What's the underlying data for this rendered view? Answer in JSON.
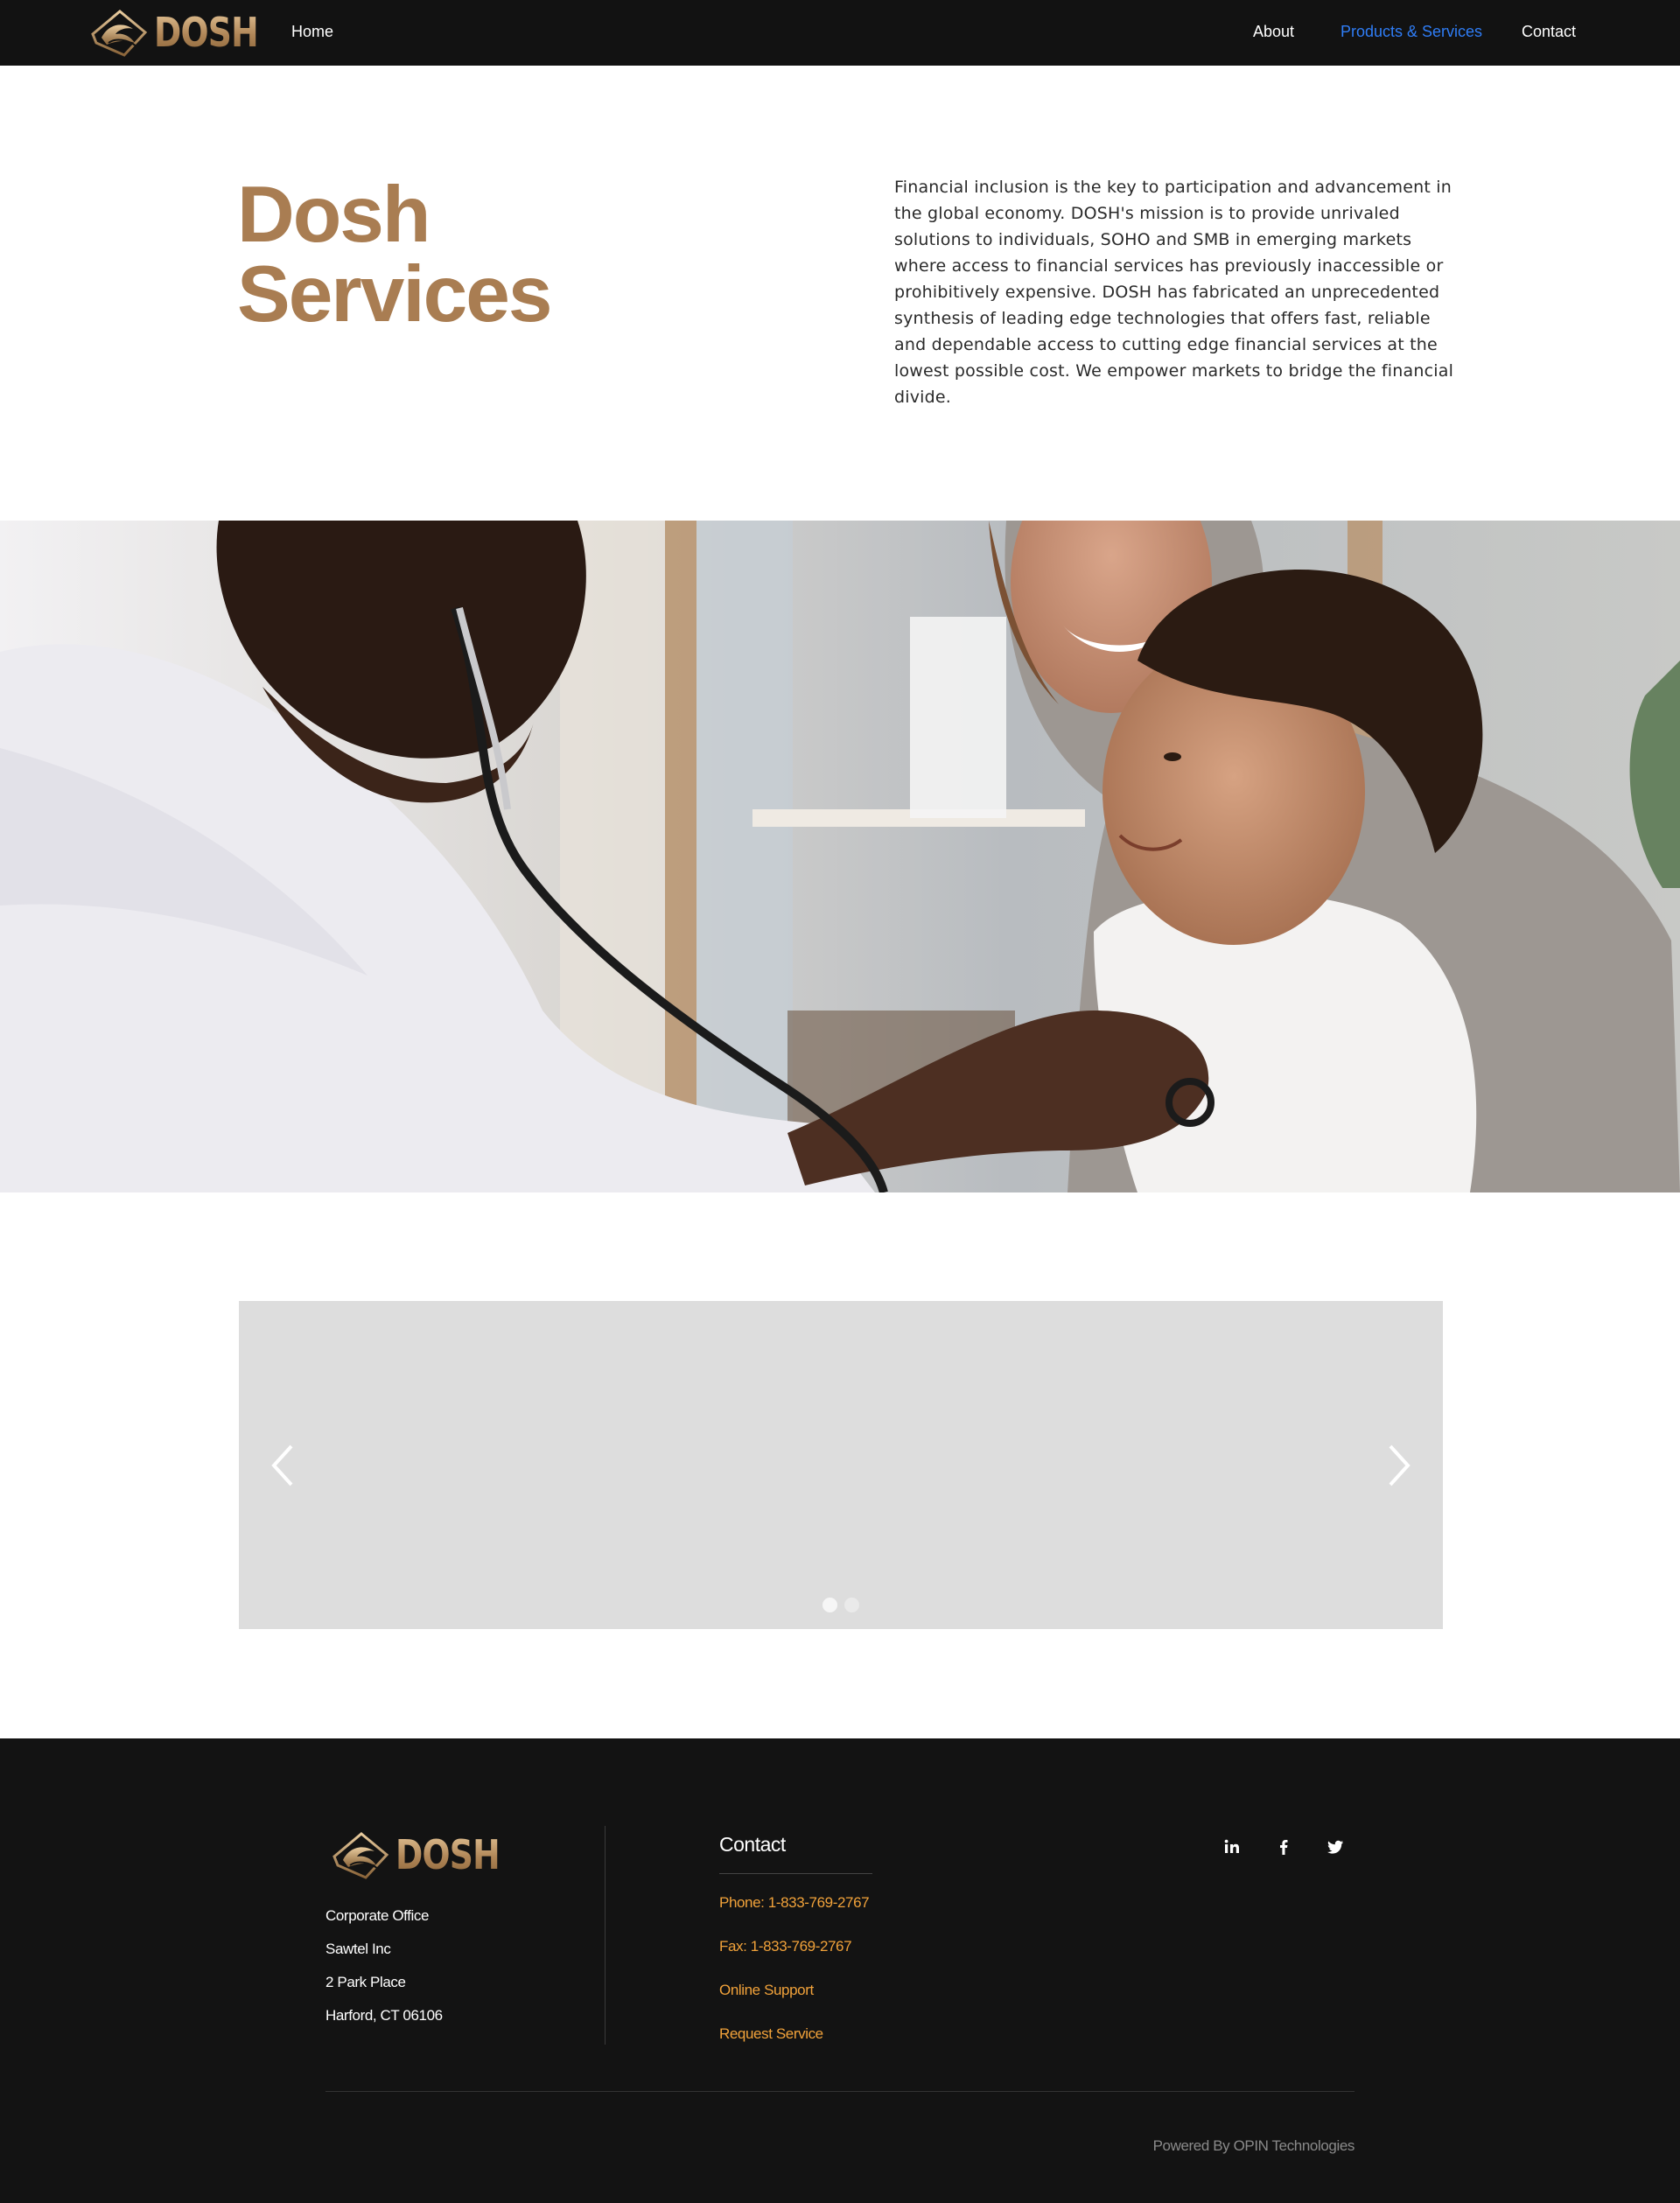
{
  "brand": {
    "logo_text": "DOSH",
    "gold": "#b08657",
    "dark": "#121212",
    "nav_active_color": "#2f7df6",
    "link_color": "#f1a23a"
  },
  "nav": {
    "items": [
      {
        "label": "Home",
        "active": false
      },
      {
        "label": "About",
        "active": false
      },
      {
        "label": "Products & Services",
        "active": true
      },
      {
        "label": "Contact",
        "active": false
      }
    ]
  },
  "hero": {
    "title_line1": "Dosh",
    "title_line2": "Services",
    "description": "Financial inclusion is the key to participation and advancement in the global economy. DOSH's mission is to provide unrivaled solutions to individuals, SOHO and SMB in emerging markets where access to financial services has previously inaccessible or prohibitively expensive. DOSH has fabricated an unprecedented synthesis of leading edge technologies that offers fast, reliable and dependable access to cutting edge financial services at the lowest possible cost. We empower markets to bridge the financial divide."
  },
  "photo": {
    "subject": "doctor with stethoscope examining smiling child held by mother"
  },
  "slideshow": {
    "prev_icon": "chevron-left-icon",
    "next_icon": "chevron-right-icon",
    "slides": 2,
    "active_slide": 1
  },
  "footer": {
    "logo_text": "DOSH",
    "address": {
      "line1": "Corporate Office",
      "line2": "Sawtel Inc",
      "line3": "2 Park Place",
      "line4": "Harford, CT 06106"
    },
    "contact": {
      "title": "Contact",
      "phone": "Phone: 1-833-769-2767",
      "fax": "Fax: 1-833-769-2767",
      "online_support": "Online Support",
      "request_service": "Request Service"
    },
    "social": [
      "linkedin-icon",
      "facebook-icon",
      "twitter-icon"
    ],
    "powered_by": "Powered By OPIN Technologies"
  }
}
